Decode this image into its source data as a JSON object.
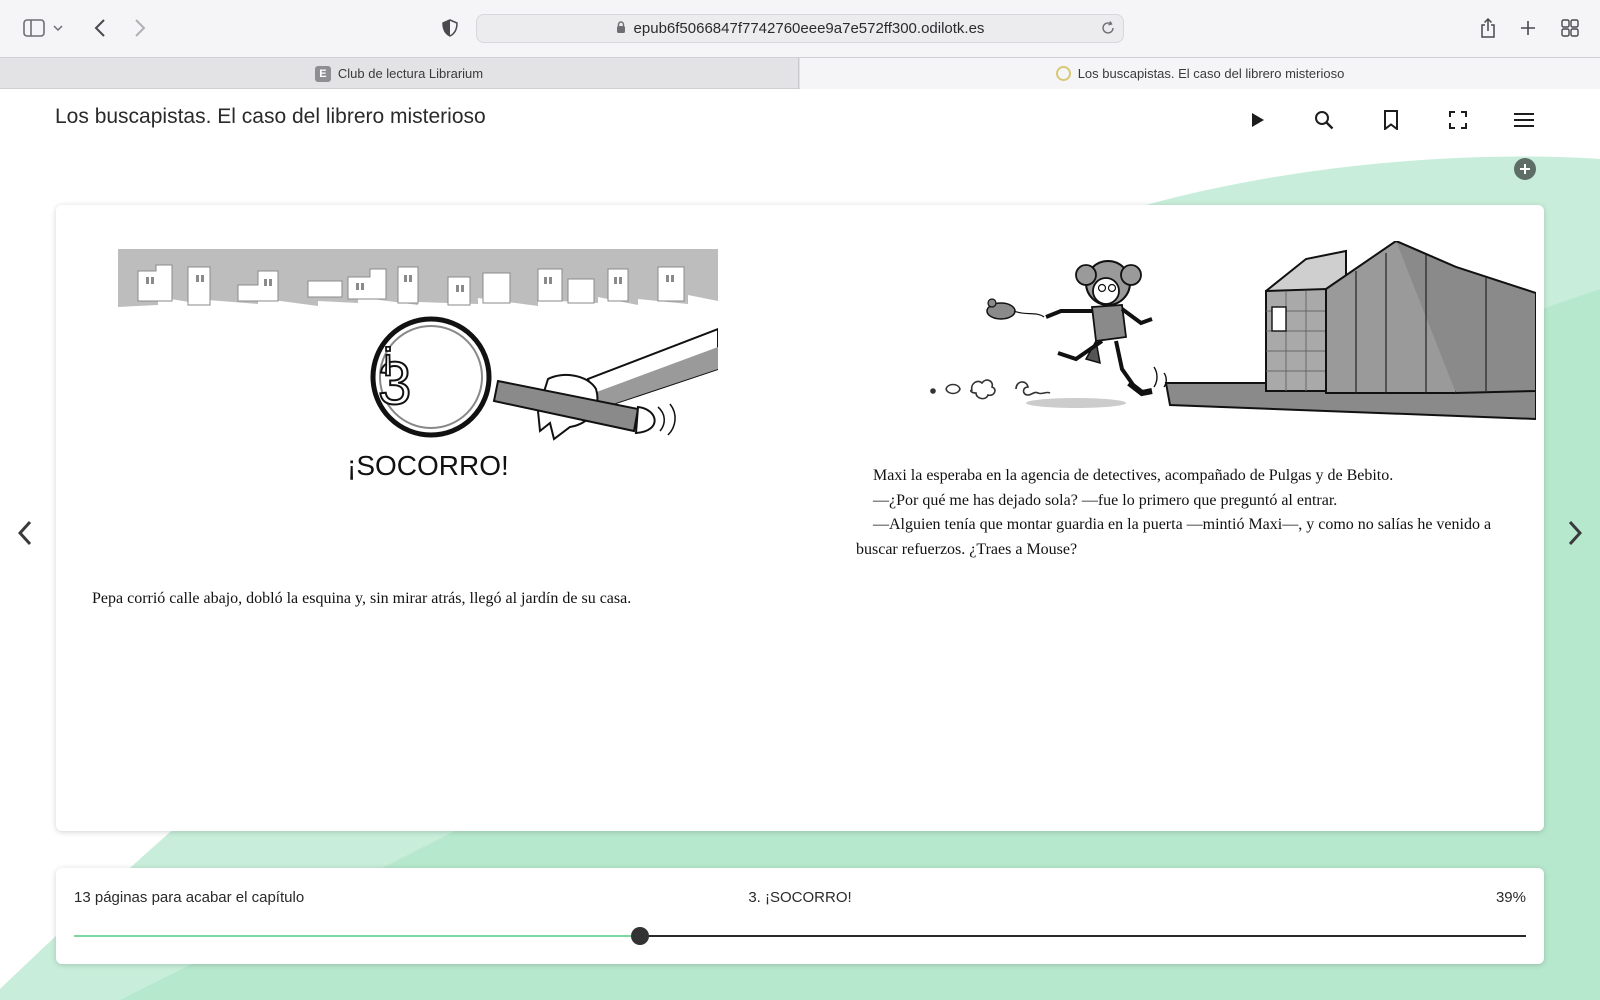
{
  "browser": {
    "url": "epub6f5066847f7742760eee9a7e572ff300.odilotk.es",
    "tabs": [
      {
        "label": "Club de lectura Librarium",
        "favicon": "E",
        "active": false
      },
      {
        "label": "Los buscapistas. El caso del librero misterioso",
        "active": true
      }
    ]
  },
  "reader": {
    "title": "Los buscapistas. El caso del librero misterioso",
    "icons": [
      "play-icon",
      "search-icon",
      "bookmark-icon",
      "fullscreen-icon",
      "menu-icon",
      "add-icon",
      "prev-page-icon",
      "next-page-icon"
    ],
    "left_page": {
      "chapter_heading_image_text": "¡SOCORRO!",
      "chapter_number_image_text": "3",
      "paragraph": "Pepa corrió calle abajo, dobló la esquina y, sin mirar atrás, llegó al jardín de su casa."
    },
    "right_page": {
      "paragraphs": [
        "Maxi la esperaba en la agencia de detectives, acompañado de Pulgas y de Bebito.",
        "—¿Por qué me has dejado sola? —fue lo primero que preguntó al entrar.",
        "—Alguien tenía que montar guardia en la puerta —mintió Maxi—, y como no salías he venido a buscar refuerzos. ¿Traes a Mouse?"
      ]
    },
    "progress": {
      "remaining_label": "13 páginas para acabar el capítulo",
      "chapter_label": "3. ¡SOCORRO!",
      "percent_label": "39%",
      "value": 0.39
    },
    "colors": {
      "accent": "#7fd6a4",
      "background_wave": "#c8eedb"
    }
  }
}
